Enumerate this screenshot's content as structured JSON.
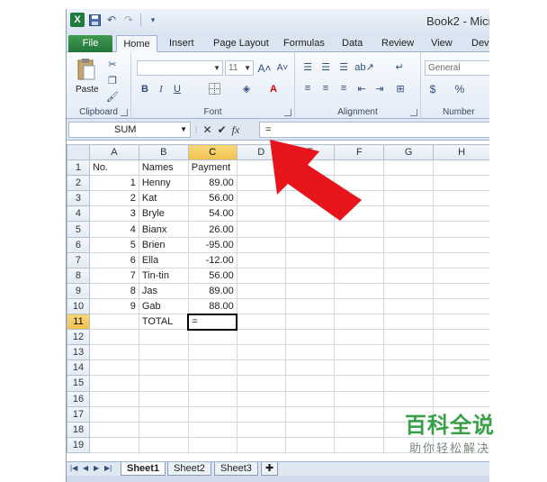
{
  "window": {
    "title": "Book2 - Micr"
  },
  "ribbon": {
    "tabs": [
      "File",
      "Home",
      "Insert",
      "Page Layout",
      "Formulas",
      "Data",
      "Review",
      "View",
      "Deve"
    ],
    "clipboard": {
      "paste_label": "Paste",
      "group_label": "Clipboard"
    },
    "font": {
      "font_size": "11",
      "group_label": "Font",
      "bold": "B",
      "italic": "I",
      "underline": "U"
    },
    "alignment": {
      "group_label": "Alignment"
    },
    "number": {
      "format": "General",
      "group_label": "Number",
      "currency": "$",
      "percent": "%"
    }
  },
  "formula_bar": {
    "name_box": "SUM",
    "fx_label": "fx",
    "cancel": "✕",
    "enter": "✔",
    "content": "="
  },
  "grid": {
    "columns": [
      "A",
      "B",
      "C",
      "D",
      "E",
      "F",
      "G",
      "H"
    ],
    "rows": [
      [
        "No.",
        "Names",
        "Payment"
      ],
      [
        "1",
        "Henny",
        "89.00"
      ],
      [
        "2",
        "Kat",
        "56.00"
      ],
      [
        "3",
        "Bryle",
        "54.00"
      ],
      [
        "4",
        "Bianx",
        "26.00"
      ],
      [
        "5",
        "Brien",
        "-95.00"
      ],
      [
        "6",
        "Ella",
        "-12.00"
      ],
      [
        "7",
        "Tin-tin",
        "56.00"
      ],
      [
        "8",
        "Jas",
        "89.00"
      ],
      [
        "9",
        "Gab",
        "88.00"
      ],
      [
        "",
        "TOTAL",
        "="
      ]
    ],
    "row_count": 19
  },
  "sheets": [
    "Sheet1",
    "Sheet2",
    "Sheet3"
  ],
  "watermark": {
    "main": "百科全说",
    "sub": "助你轻松解决"
  },
  "colors": {
    "arrow": "#e8141b",
    "excel_green": "#24743a",
    "selected_header": "#f1c04c"
  }
}
